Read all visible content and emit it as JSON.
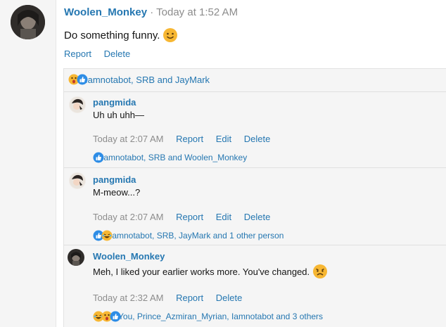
{
  "post": {
    "username": "Woolen_Monkey",
    "separator": "·",
    "time": "Today at 1:52 AM",
    "text": "Do something funny.",
    "actions": {
      "report": "Report",
      "delete": "Delete"
    },
    "reactions_summary": "Iamnotabot, SRB and JayMark"
  },
  "replies": [
    {
      "username": "pangmida",
      "text": "Uh uh uhh—",
      "time": "Today at 2:07 AM",
      "actions": {
        "report": "Report",
        "edit": "Edit",
        "delete": "Delete"
      },
      "reactions_summary": "Iamnotabot, SRB and Woolen_Monkey"
    },
    {
      "username": "pangmida",
      "text": "M-meow...?",
      "time": "Today at 2:07 AM",
      "actions": {
        "report": "Report",
        "edit": "Edit",
        "delete": "Delete"
      },
      "reactions_summary": "Iamnotabot, SRB, JayMark and 1 other person"
    },
    {
      "username": "Woolen_Monkey",
      "text": "Meh, I liked your earlier works more. You've changed.",
      "time": "Today at 2:32 AM",
      "actions": {
        "report": "Report",
        "delete": "Delete"
      },
      "reactions_summary": "You, Prince_Azmiran_Myrian, Iamnotabot and 3 others"
    }
  ],
  "colors": {
    "link": "#2577b1",
    "meta": "#8c8c8c",
    "panel": "#f5f5f5"
  }
}
